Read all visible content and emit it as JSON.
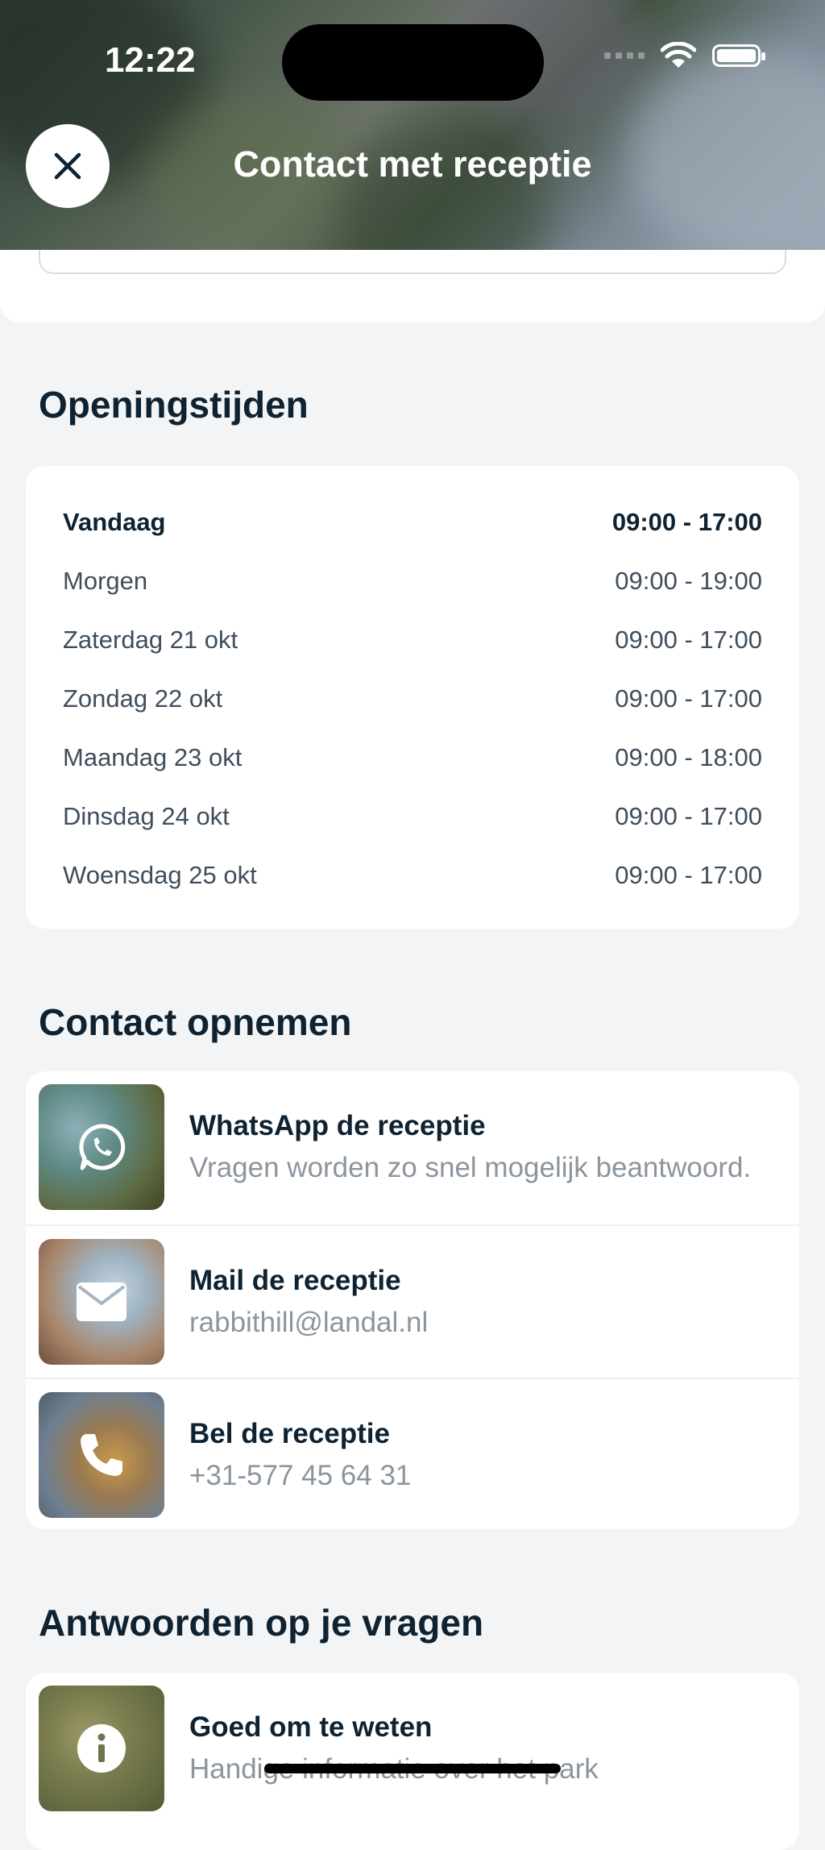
{
  "status": {
    "time": "12:22"
  },
  "header": {
    "title": "Contact met receptie"
  },
  "opening_hours": {
    "title": "Openingstijden",
    "rows": [
      {
        "day": "Vandaag",
        "hours": "09:00 - 17:00"
      },
      {
        "day": "Morgen",
        "hours": "09:00 - 19:00"
      },
      {
        "day": "Zaterdag 21 okt",
        "hours": "09:00 - 17:00"
      },
      {
        "day": "Zondag 22 okt",
        "hours": "09:00 - 17:00"
      },
      {
        "day": "Maandag 23 okt",
        "hours": "09:00 - 18:00"
      },
      {
        "day": "Dinsdag 24 okt",
        "hours": "09:00 - 17:00"
      },
      {
        "day": "Woensdag 25 okt",
        "hours": "09:00 - 17:00"
      }
    ]
  },
  "contact": {
    "title": "Contact opnemen",
    "items": [
      {
        "title": "WhatsApp de receptie",
        "subtitle": "Vragen worden zo snel mogelijk beantwoord.",
        "icon": "whatsapp-icon"
      },
      {
        "title": "Mail de receptie",
        "subtitle": "rabbithill@landal.nl",
        "icon": "mail-icon"
      },
      {
        "title": "Bel de receptie",
        "subtitle": "+31-577 45 64 31",
        "icon": "phone-icon"
      }
    ]
  },
  "answers": {
    "title": "Antwoorden op je vragen",
    "items": [
      {
        "title": "Goed om te weten",
        "subtitle": "Handige informatie over het park",
        "icon": "info-icon"
      }
    ]
  }
}
